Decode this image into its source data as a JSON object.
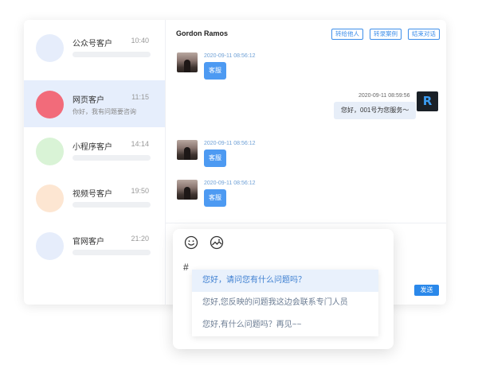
{
  "conversations": [
    {
      "name": "公众号客户",
      "time": "10:40",
      "preview": "",
      "color": "#e6edfb"
    },
    {
      "name": "网页客户",
      "time": "11:15",
      "preview": "你好，我有问题要咨询",
      "color": "#f26b7a"
    },
    {
      "name": "小程序客户",
      "time": "14:14",
      "preview": "",
      "color": "#d9f3d6"
    },
    {
      "name": "视频号客户",
      "time": "19:50",
      "preview": "",
      "color": "#fde6d2"
    },
    {
      "name": "官网客户",
      "time": "21:20",
      "preview": "",
      "color": "#e6edfb"
    }
  ],
  "chat": {
    "contact_name": "Gordon Ramos",
    "buttons": {
      "transfer": "转给他人",
      "record_case": "转录案例",
      "end": "结束对话"
    },
    "messages": [
      {
        "direction": "in",
        "time": "2020-09-11 08:56:12",
        "text": "客服"
      },
      {
        "direction": "out",
        "time": "2020-09-11 08:59:56",
        "text": "您好，001号为您服务～"
      },
      {
        "direction": "in",
        "time": "2020-09-11 08:56:12",
        "text": "客服"
      },
      {
        "direction": "in",
        "time": "2020-09-11 08:56:12",
        "text": "客服"
      }
    ],
    "brand_logo_letter": "R",
    "send_label": "发送"
  },
  "input": {
    "typed": "#",
    "icons": [
      "emoji-icon",
      "image-icon"
    ],
    "suggestions": [
      "您好，请问您有什么问题吗？",
      "您好,您反映的问题我这边会联系专门人员",
      "您好,有什么问题吗？再见~~"
    ]
  },
  "colors": {
    "accent": "#2a88ea",
    "bubble_in": "#4d9af2",
    "bubble_out": "#e7eef8",
    "active_row": "#e6eefc"
  }
}
